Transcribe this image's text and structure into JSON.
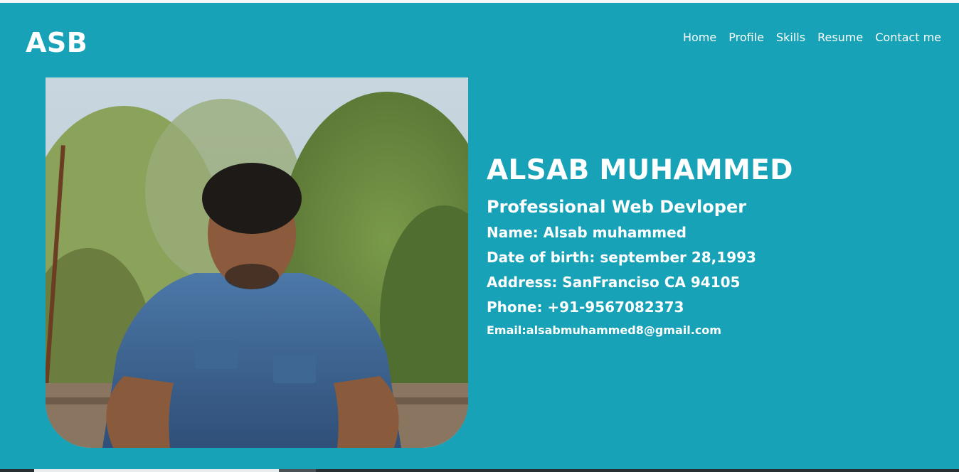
{
  "brand": "ASB",
  "nav": {
    "items": [
      {
        "label": "Home"
      },
      {
        "label": "Profile"
      },
      {
        "label": "Skills"
      },
      {
        "label": "Resume"
      },
      {
        "label": "Contact me"
      }
    ]
  },
  "profile": {
    "name": "ALSAB MUHAMMED",
    "role": "Professional Web Devloper",
    "details": {
      "name": "Name: Alsab muhammed",
      "dob": "Date of birth: september 28,1993",
      "address": "Address: SanFranciso CA 94105",
      "phone": "Phone: +91-9567082373",
      "email": "Email:alsabmuhammed8@gmail.com"
    }
  },
  "colors": {
    "background": "#17a2b8",
    "text": "#ffffff"
  }
}
